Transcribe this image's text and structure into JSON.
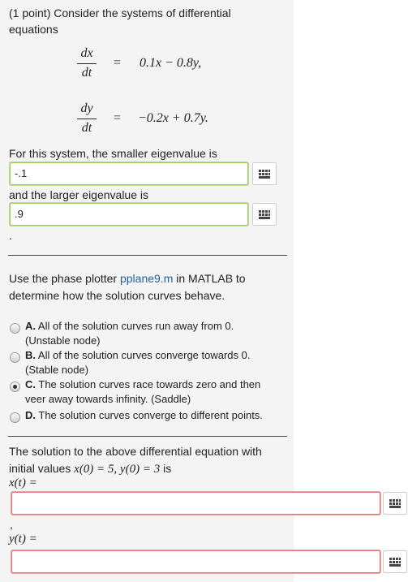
{
  "intro": {
    "line1": "(1 point) Consider the systems of differential",
    "line2": "equations"
  },
  "equations": [
    {
      "num": "dx",
      "den": "dt",
      "eq": "=",
      "rhs": "0.1x − 0.8y,"
    },
    {
      "num": "dy",
      "den": "dt",
      "eq": "=",
      "rhs": "−0.2x + 0.7y."
    }
  ],
  "q1": {
    "smaller_label": "For this system, the smaller eigenvalue is",
    "smaller_value": "-.1",
    "larger_label": "and the larger eigenvalue is",
    "larger_value": ".9",
    "period": "."
  },
  "q2": {
    "prompt_before": "Use the phase plotter ",
    "link": "pplane9.m",
    "prompt_after": " in MATLAB to",
    "prompt_line2": "determine how the solution curves behave.",
    "options": [
      {
        "letter": "A.",
        "line1": "All of the solution curves run away from 0.",
        "line2": "(Unstable node)",
        "checked": false
      },
      {
        "letter": "B.",
        "line1": "All of the solution curves converge towards 0.",
        "line2": "(Stable node)",
        "checked": false
      },
      {
        "letter": "C.",
        "line1": "The solution curves race towards zero and then",
        "line2": "veer away towards infinity. (Saddle)",
        "checked": true
      },
      {
        "letter": "D.",
        "line1": "The solution curves converge to different points.",
        "line2": "",
        "checked": false
      }
    ]
  },
  "q3": {
    "line1": "The solution to the above differential equation with",
    "line2_text": "initial values",
    "line2_math": "x(0) = 5,  y(0) = 3",
    "line2_end": "is",
    "x_label": "x(t) =",
    "comma": ",",
    "y_label": "y(t) =",
    "x_value": "",
    "y_value": ""
  },
  "icons": {
    "keypad": "keypad-grid-icon"
  },
  "colors": {
    "valid_border": "#9ccc65",
    "invalid_border": "#e57373",
    "link": "#1f5fa5",
    "panel_bg": "#f4f4f4"
  }
}
